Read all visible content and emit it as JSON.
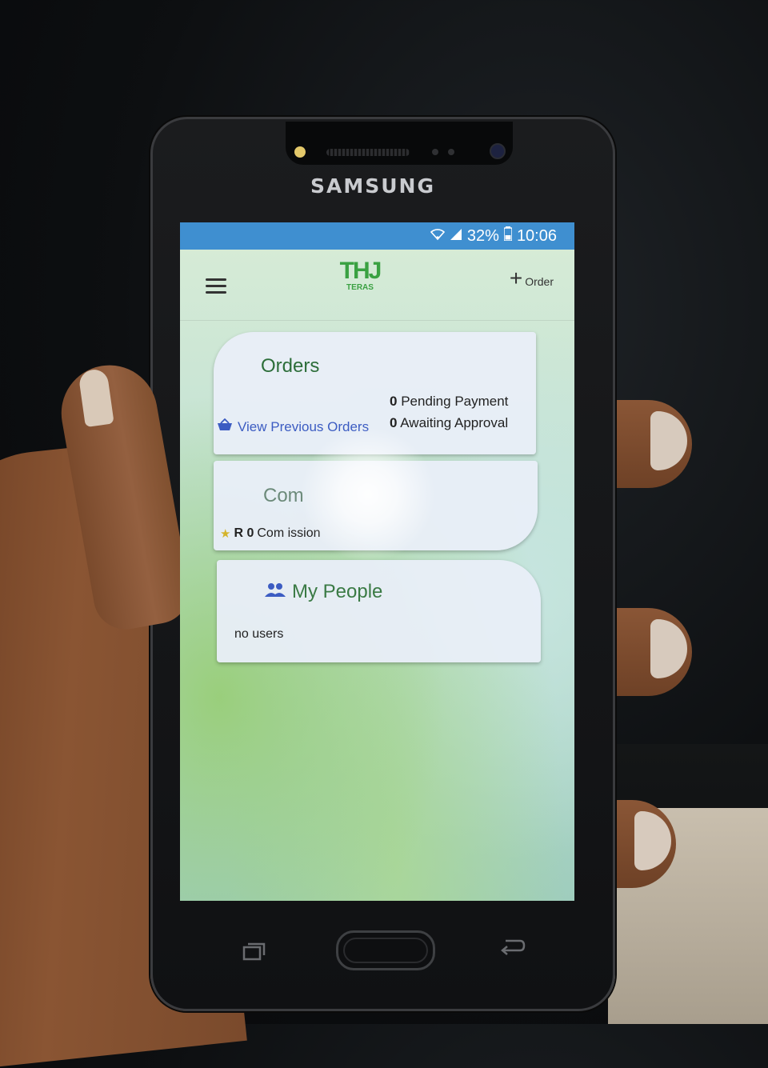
{
  "device": {
    "brand": "SAMSUNG"
  },
  "status_bar": {
    "battery": "32%",
    "time": "10:06",
    "icons": [
      "wifi-icon",
      "signal-icon",
      "battery-icon"
    ]
  },
  "app_bar": {
    "menu_icon": "hamburger-menu-icon",
    "logo_text": "THJ",
    "logo_sub": "TERAS",
    "add_order_icon": "plus-icon",
    "add_order_label": "Order"
  },
  "orders_card": {
    "title": "Orders",
    "pending_count": "0",
    "pending_label": "Pending Payment",
    "awaiting_count": "0",
    "awaiting_label": "Awaiting Approval",
    "view_previous_icon": "basket-icon",
    "view_previous_label": "View Previous Orders"
  },
  "commission_card": {
    "title": "Com",
    "icon": "star-icon",
    "amount": "R 0",
    "label": "Com  ission"
  },
  "people_card": {
    "icon": "people-icon",
    "title": "My People",
    "empty_text": "no users"
  },
  "colors": {
    "status_bar": "#3f8fd0",
    "accent_green": "#3aa142",
    "link_blue": "#3c5cc2"
  }
}
